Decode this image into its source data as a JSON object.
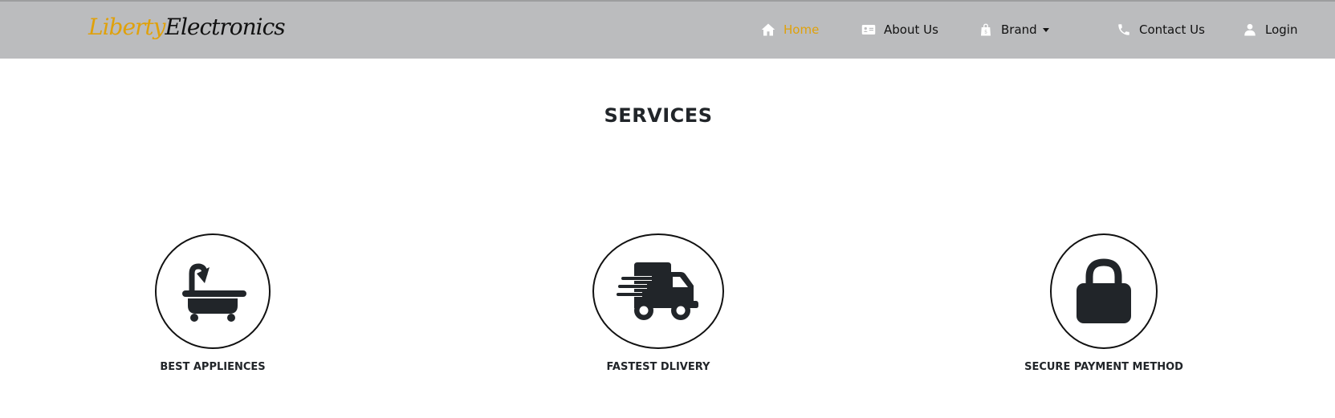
{
  "brand": {
    "part1": "Liberty",
    "part2": "Electronics"
  },
  "nav": {
    "home": "Home",
    "about": "About Us",
    "brand": "Brand",
    "contact": "Contact Us",
    "login": "Login"
  },
  "colors": {
    "accent": "#e0a10a",
    "navbar_bg": "#bbbcbe",
    "text": "#212529"
  },
  "services": {
    "title": "SERVICES",
    "items": [
      {
        "label": "BEST APPLIENCES",
        "icon": "bathtub-icon"
      },
      {
        "label": "FASTEST DLIVERY",
        "icon": "truck-fast-icon"
      },
      {
        "label": "SECURE PAYMENT METHOD",
        "icon": "lock-icon"
      }
    ]
  }
}
